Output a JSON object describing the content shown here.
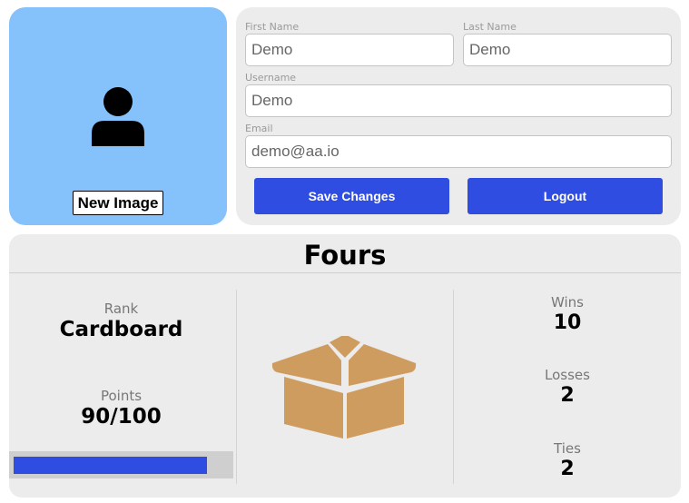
{
  "profile": {
    "new_image_label": "New Image",
    "first_name": {
      "label": "First Name",
      "value": "Demo"
    },
    "last_name": {
      "label": "Last Name",
      "value": "Demo"
    },
    "username": {
      "label": "Username",
      "value": "Demo"
    },
    "email": {
      "label": "Email",
      "value": "demo@aa.io"
    },
    "save_label": "Save Changes",
    "logout_label": "Logout"
  },
  "stats": {
    "title": "Fours",
    "rank_label": "Rank",
    "rank_value": "Cardboard",
    "points_label": "Points",
    "points_value": "90/100",
    "points_progress": 0.9,
    "rank_icon": "cardboard-box-icon",
    "wins_label": "Wins",
    "wins_value": "10",
    "losses_label": "Losses",
    "losses_value": "2",
    "ties_label": "Ties",
    "ties_value": "2"
  },
  "colors": {
    "accent": "#2f4de0",
    "avatar_bg": "#85c1fb",
    "panel_bg": "#ececec",
    "box_color": "#cf9c60"
  }
}
